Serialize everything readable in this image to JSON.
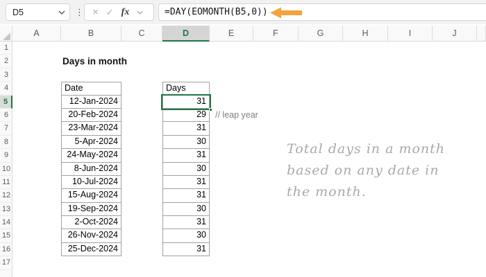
{
  "formula_bar": {
    "name_box": "D5",
    "cancel_label": "×",
    "enter_label": "✓",
    "fx_label": "fx",
    "formula": "=DAY(EOMONTH(B5,0))"
  },
  "column_headers": [
    "A",
    "B",
    "C",
    "D",
    "E",
    "F",
    "G",
    "H",
    "I",
    "J"
  ],
  "row_headers": [
    "1",
    "2",
    "3",
    "4",
    "5",
    "6",
    "7",
    "8",
    "9",
    "10",
    "11",
    "12",
    "13",
    "14",
    "15",
    "16",
    "17"
  ],
  "active_cell": "D5",
  "sheet": {
    "title": "Days in month",
    "table": {
      "date_header": "Date",
      "days_header": "Days",
      "rows": [
        {
          "date": "12-Jan-2024",
          "days": "31"
        },
        {
          "date": "20-Feb-2024",
          "days": "29"
        },
        {
          "date": "23-Mar-2024",
          "days": "31"
        },
        {
          "date": "5-Apr-2024",
          "days": "30"
        },
        {
          "date": "24-May-2024",
          "days": "31"
        },
        {
          "date": "8-Jun-2024",
          "days": "30"
        },
        {
          "date": "10-Jul-2024",
          "days": "31"
        },
        {
          "date": "15-Aug-2024",
          "days": "31"
        },
        {
          "date": "19-Sep-2024",
          "days": "30"
        },
        {
          "date": "2-Oct-2024",
          "days": "31"
        },
        {
          "date": "26-Nov-2024",
          "days": "30"
        },
        {
          "date": "25-Dec-2024",
          "days": "31"
        }
      ]
    },
    "leap_year_note": "// leap year",
    "annotation_lines": [
      "Total days in a month",
      "based on any date in",
      "the month."
    ]
  },
  "colors": {
    "excel_green": "#217346",
    "date_header_fill": "#DAD6F0",
    "days_header_fill": "#E2EFDA",
    "arrow_orange": "#F2A33C",
    "table_border": "#A0A0A0",
    "annotation_gray": "#A9A9A9",
    "note_gray": "#7F7F7F"
  }
}
